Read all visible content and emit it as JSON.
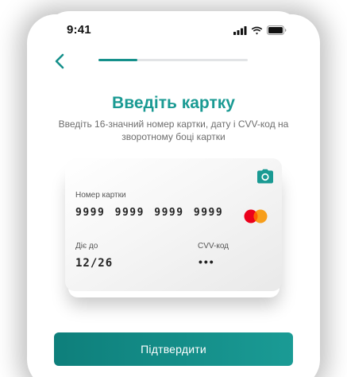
{
  "status_bar": {
    "time": "9:41",
    "icons": [
      "cellular-signal-icon",
      "wifi-icon",
      "battery-icon"
    ]
  },
  "nav": {
    "back_icon": "chevron-left-icon",
    "progress": 0.26
  },
  "header": {
    "title": "Введіть картку",
    "subtitle": "Введіть 16-значний номер картки, дату і CVV-код на зворотному боці картки"
  },
  "card": {
    "camera_icon": "camera-icon",
    "number_label": "Номер картки",
    "number_value": "9999 9999 9999 9999",
    "expiry_label": "Діє до",
    "expiry_value": "12/26",
    "cvv_label": "CVV-код",
    "cvv_value": "•••",
    "brand_icon": "mastercard-logo"
  },
  "actions": {
    "confirm_label": "Підтвердити"
  },
  "colors": {
    "accent": "#1a9a93",
    "button": "#138a85"
  }
}
